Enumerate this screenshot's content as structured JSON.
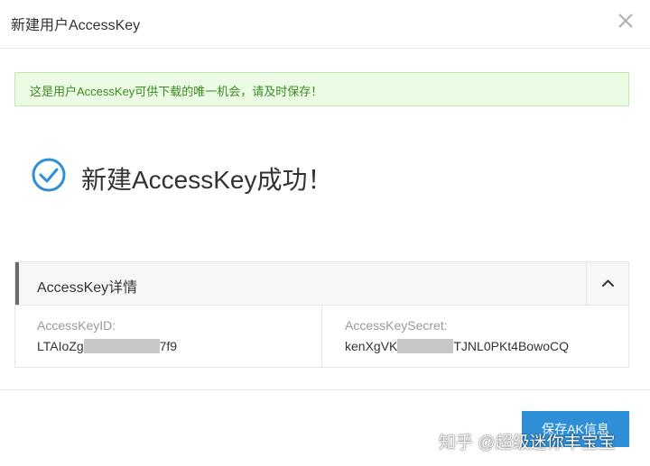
{
  "header": {
    "title": "新建用户AccessKey",
    "close_icon": "close-icon"
  },
  "notice": {
    "text": "这是用户AccessKey可供下载的唯一机会，请及时保存！"
  },
  "success": {
    "icon": "check-circle-icon",
    "message": "新建AccessKey成功！"
  },
  "details": {
    "title": "AccessKey详情",
    "toggle_icon": "chevron-up-icon",
    "id": {
      "label": "AccessKeyID:",
      "value_start": "LTAIoZg",
      "value_end": "7f9"
    },
    "secret": {
      "label": "AccessKeySecret:",
      "value_start": "kenXgVK",
      "value_end": "TJNL0PKt4BowoCQ"
    }
  },
  "footer": {
    "save_label": "保存AK信息"
  },
  "watermark": {
    "text": "知乎 @超级迷你丰宝宝"
  },
  "colors": {
    "accent": "#2e8ed6",
    "notice_bg": "#ecfbe4",
    "notice_text": "#3c8a23",
    "check": "#2e8ed6"
  }
}
